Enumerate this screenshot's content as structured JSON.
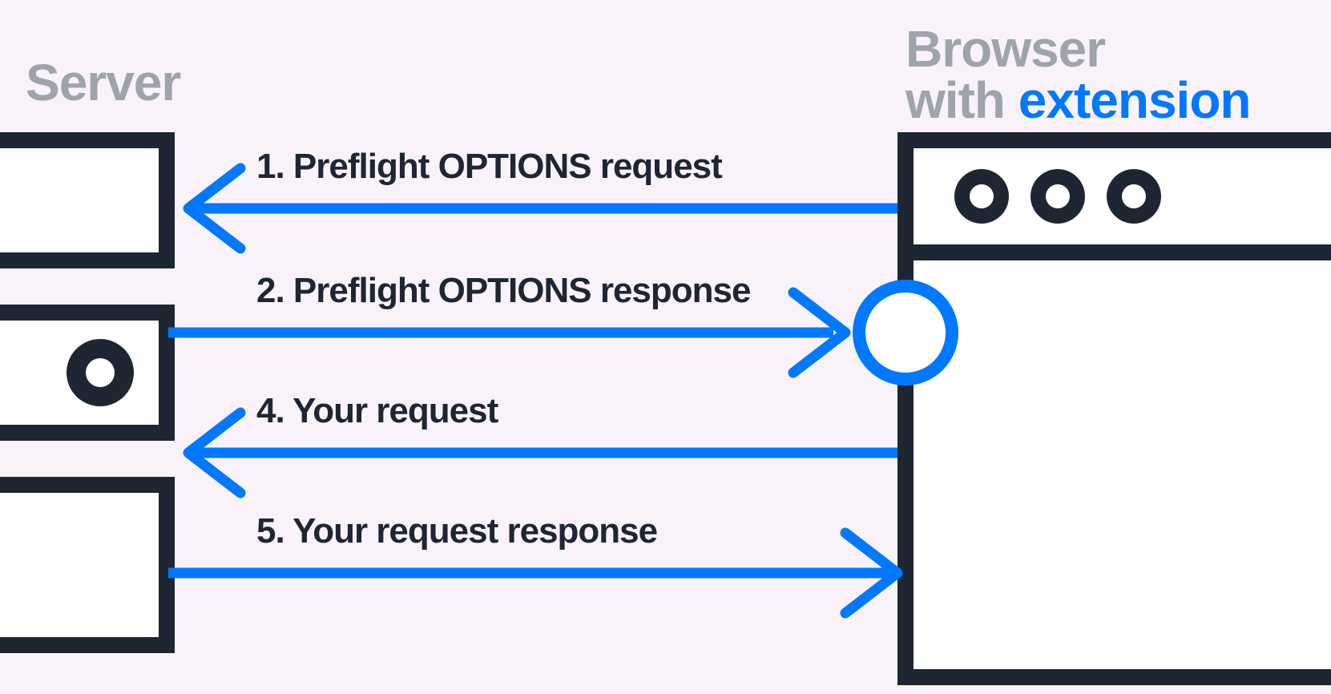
{
  "titles": {
    "server": "Server",
    "browser_line1": "Browser",
    "browser_line2_prefix": "with ",
    "browser_line2_highlight": "extension"
  },
  "steps": {
    "s1": "1. Preflight OPTIONS request",
    "s2": "2. Preflight OPTIONS response",
    "s4": "4. Your request",
    "s5": "5. Your request response"
  },
  "colors": {
    "bg": "#f9f3f9",
    "dark": "#1f2633",
    "blue": "#0078ff",
    "grey": "#9ea3ac",
    "white": "#ffffff"
  }
}
